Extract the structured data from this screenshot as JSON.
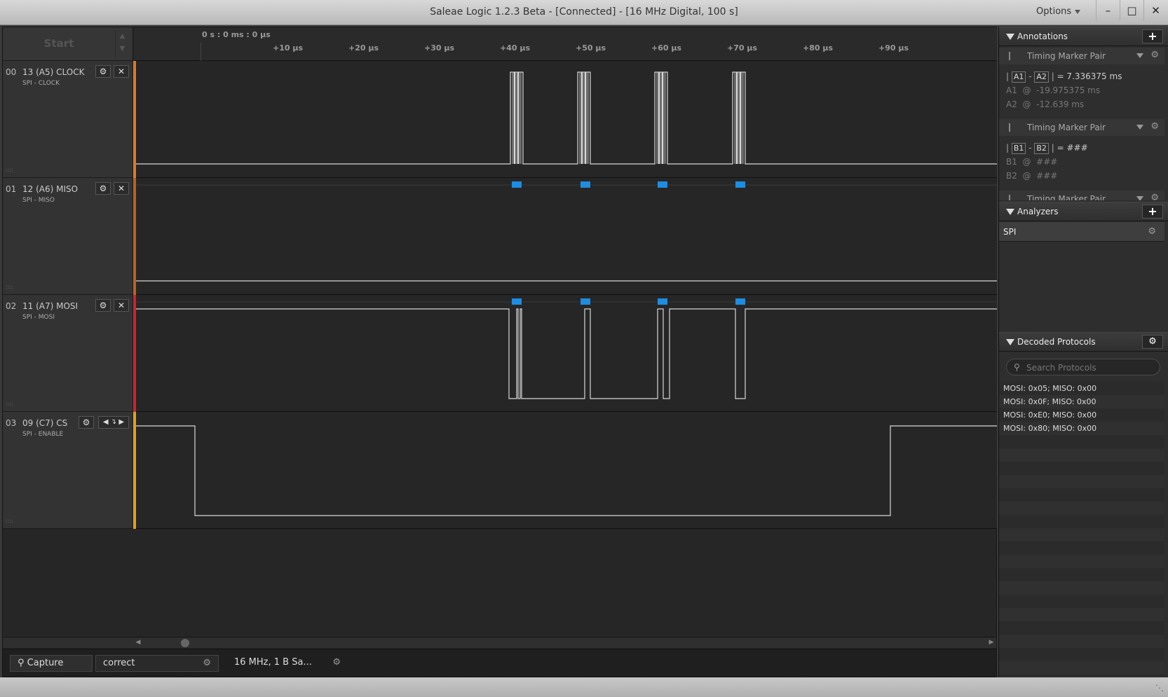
{
  "window": {
    "title": "Saleae Logic 1.2.3 Beta - [Connected] - [16 MHz Digital, 100 s]",
    "options_label": "Options",
    "minimize": "–",
    "maximize": "□",
    "close": "✕"
  },
  "timeline": {
    "start_label": "Start",
    "origin": "0 s : 0 ms : 0 µs",
    "ticks": [
      "+10 µs",
      "+20 µs",
      "+30 µs",
      "+40 µs",
      "+50 µs",
      "+60 µs",
      "+70 µs",
      "+80 µs",
      "+90 µs"
    ]
  },
  "channels": [
    {
      "num": "00",
      "name": "13 (A5) CLOCK",
      "sub": "SPI - CLOCK",
      "color": "#e0791e"
    },
    {
      "num": "01",
      "name": "12 (A6) MISO",
      "sub": "SPI - MISO",
      "color": "#c0601a"
    },
    {
      "num": "02",
      "name": "11 (A7) MOSI",
      "sub": "SPI - MOSI",
      "color": "#d81f2a"
    },
    {
      "num": "03",
      "name": "09 (C7) CS",
      "sub": "SPI - ENABLE",
      "color": "#e8a010"
    }
  ],
  "annotations": {
    "title": "Annotations",
    "pairs": [
      {
        "title": "Timing Marker Pair",
        "m1": "A1",
        "m2": "A2",
        "delta": "= 7.336375 ms",
        "v1": "-19.975375 ms",
        "v2": "-12.639 ms"
      },
      {
        "title": "Timing Marker Pair",
        "m1": "B1",
        "m2": "B2",
        "delta": "= ###",
        "v1": "###",
        "v2": "###"
      },
      {
        "title": "Timing Marker Pair"
      }
    ]
  },
  "analyzers": {
    "title": "Analyzers",
    "items": [
      "SPI"
    ]
  },
  "decoded": {
    "title": "Decoded Protocols",
    "search_placeholder": "Search Protocols",
    "rows": [
      "MOSI: 0x05;  MISO: 0x00",
      "MOSI: 0x0F;  MISO: 0x00",
      "MOSI: 0xE0;  MISO: 0x00",
      "MOSI: 0x80;  MISO: 0x00"
    ]
  },
  "statusbar": {
    "capture": "Capture",
    "session": "correct",
    "rate": "16 MHz, 1 B Sa..."
  },
  "colors": {
    "accent_blue": "#1e8ce0",
    "wave_line": "#d8d8d8"
  }
}
